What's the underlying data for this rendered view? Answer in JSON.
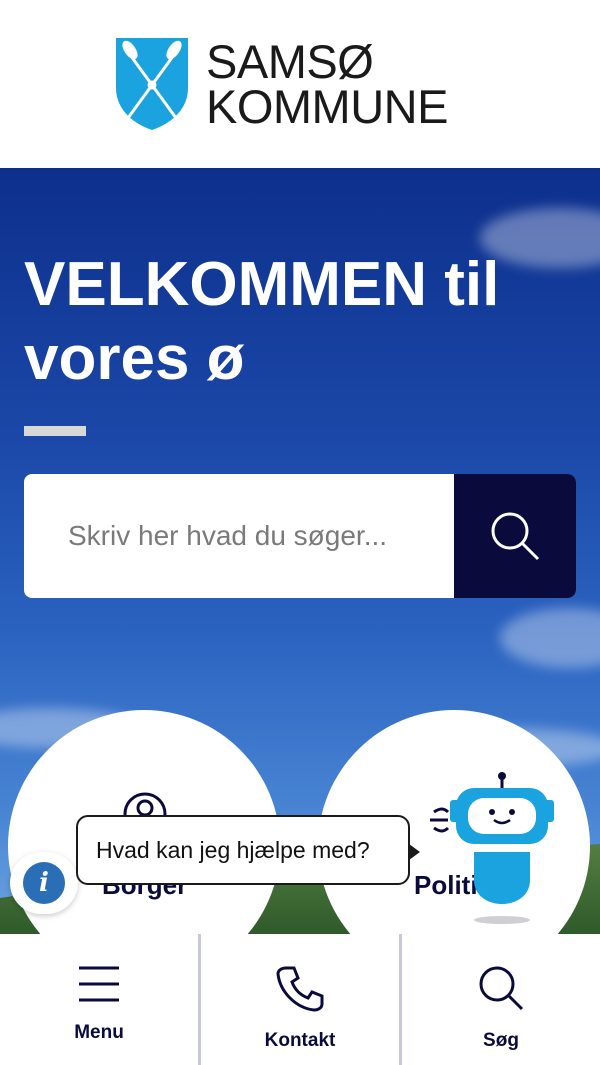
{
  "header": {
    "logo_line1": "SAMSØ",
    "logo_line2": "KOMMUNE",
    "logo_icon": "crossed-oars-shield",
    "brand_blue": "#1aa3df"
  },
  "hero": {
    "title": "VELKOMMEN til vores ø",
    "search_placeholder": "Skriv her hvad du søger...",
    "search_icon": "search-icon",
    "search_button_color": "#0a0a3c"
  },
  "categories": {
    "left_label": "Borger",
    "right_label": "Politik"
  },
  "chat": {
    "bubble_text": "Hvad kan jeg hjælpe med?",
    "info_icon": "info-icon",
    "bot_icon": "chatbot-icon"
  },
  "bottom_nav": {
    "items": [
      {
        "label": "Menu",
        "icon": "hamburger-icon"
      },
      {
        "label": "Kontakt",
        "icon": "phone-icon"
      },
      {
        "label": "Søg",
        "icon": "search-icon"
      }
    ]
  }
}
